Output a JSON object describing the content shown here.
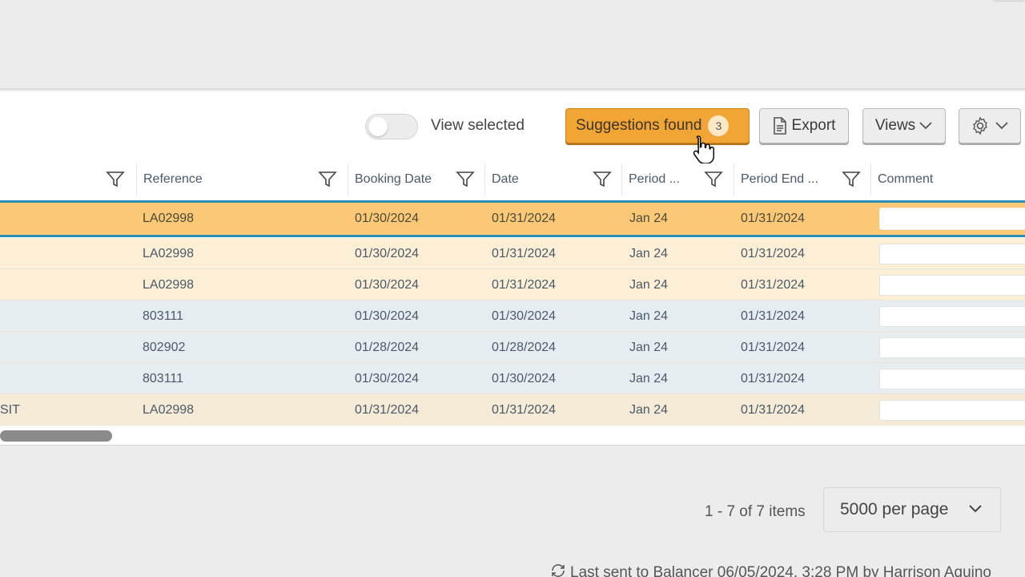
{
  "toolbar": {
    "view_selected_label": "View selected",
    "suggestions_label": "Suggestions found",
    "suggestions_count": "3",
    "export_label": "Export",
    "views_label": "Views"
  },
  "columns": [
    {
      "label": ""
    },
    {
      "label": "Reference"
    },
    {
      "label": "Booking Date"
    },
    {
      "label": "Date"
    },
    {
      "label": "Period ..."
    },
    {
      "label": "Period End ..."
    },
    {
      "label": "Comment"
    }
  ],
  "rows": [
    {
      "first": "",
      "reference": "LA02998",
      "booking_date": "01/30/2024",
      "date": "01/31/2024",
      "period": "Jan 24",
      "period_end": "01/31/2024",
      "comment": "",
      "status": "selected",
      "bg": "#fbc976"
    },
    {
      "first": "",
      "reference": "LA02998",
      "booking_date": "01/30/2024",
      "date": "01/31/2024",
      "period": "Jan 24",
      "period_end": "01/31/2024",
      "comment": "",
      "status": "suggested",
      "bg": "#fdefd6"
    },
    {
      "first": "",
      "reference": "LA02998",
      "booking_date": "01/30/2024",
      "date": "01/31/2024",
      "period": "Jan 24",
      "period_end": "01/31/2024",
      "comment": "",
      "status": "suggested",
      "bg": "#fdefd6"
    },
    {
      "first": "",
      "reference": "803111",
      "booking_date": "01/30/2024",
      "date": "01/30/2024",
      "period": "Jan 24",
      "period_end": "01/31/2024",
      "comment": "",
      "status": "other",
      "bg": "#e5edf1"
    },
    {
      "first": "",
      "reference": "802902",
      "booking_date": "01/28/2024",
      "date": "01/28/2024",
      "period": "Jan 24",
      "period_end": "01/31/2024",
      "comment": "",
      "status": "other",
      "bg": "#e5edf1"
    },
    {
      "first": "",
      "reference": "803111",
      "booking_date": "01/30/2024",
      "date": "01/30/2024",
      "period": "Jan 24",
      "period_end": "01/31/2024",
      "comment": "",
      "status": "other",
      "bg": "#e5edf1"
    },
    {
      "first": "SIT",
      "reference": "LA02998",
      "booking_date": "01/31/2024",
      "date": "01/31/2024",
      "period": "Jan 24",
      "period_end": "01/31/2024",
      "comment": "",
      "status": "other",
      "bg": "#f4ead6"
    }
  ],
  "pager": {
    "range_text": "1 - 7 of 7 items",
    "per_page": "5000 per page"
  },
  "footer": {
    "last_sent": "Last sent to Balancer 06/05/2024, 3:28 PM by Harrison Aquino"
  },
  "colors": {
    "accent_orange": "#f0a535",
    "selected_border": "#2a8fb4"
  }
}
